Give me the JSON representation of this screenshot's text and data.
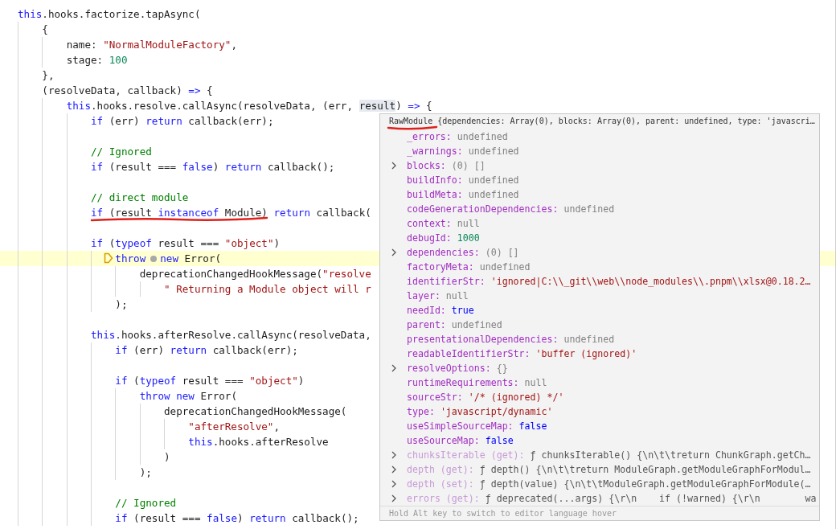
{
  "editor": {
    "lines": [
      {
        "current": false,
        "tokens": [
          {
            "kind": "kw",
            "text": "this"
          },
          {
            "kind": "p",
            "text": ".hooks.factorize.tapAsync("
          }
        ],
        "children": [
          {
            "current": false,
            "tokens": [
              {
                "kind": "p",
                "text": "{"
              }
            ],
            "children": [
              {
                "current": false,
                "tokens": [
                  {
                    "kind": "p",
                    "text": "name: "
                  },
                  {
                    "kind": "str",
                    "text": "\"NormalModuleFactory\""
                  },
                  {
                    "kind": "p",
                    "text": ","
                  }
                ]
              },
              {
                "current": false,
                "tokens": [
                  {
                    "kind": "p",
                    "text": "stage: "
                  },
                  {
                    "kind": "num",
                    "text": "100"
                  }
                ]
              }
            ]
          },
          {
            "current": false,
            "tokens": [
              {
                "kind": "p",
                "text": "},"
              }
            ]
          },
          {
            "current": false,
            "tokens": [
              {
                "kind": "p",
                "text": "(resolveData, callback) "
              },
              {
                "kind": "kw",
                "text": "=>"
              },
              {
                "kind": "p",
                "text": " {"
              }
            ],
            "children": [
              {
                "current": false,
                "tokens": [
                  {
                    "kind": "kw",
                    "text": "this"
                  },
                  {
                    "kind": "p",
                    "text": ".hooks.resolve.callAsync(resolveData, (err, "
                  },
                  {
                    "kind": "hl",
                    "text": "result"
                  },
                  {
                    "kind": "p",
                    "text": ") "
                  },
                  {
                    "kind": "kw",
                    "text": "=>"
                  },
                  {
                    "kind": "p",
                    "text": " {"
                  }
                ],
                "children": [
                  {
                    "current": false,
                    "tokens": [
                      {
                        "kind": "kw",
                        "text": "if"
                      },
                      {
                        "kind": "p",
                        "text": " (err) "
                      },
                      {
                        "kind": "kw",
                        "text": "return"
                      },
                      {
                        "kind": "p",
                        "text": " callback(err);"
                      }
                    ]
                  },
                  {
                    "current": false
                  },
                  {
                    "current": false,
                    "tokens": [
                      {
                        "kind": "cmt",
                        "text": "// Ignored"
                      }
                    ]
                  },
                  {
                    "current": false,
                    "tokens": [
                      {
                        "kind": "kw",
                        "text": "if"
                      },
                      {
                        "kind": "p",
                        "text": " (result === "
                      },
                      {
                        "kind": "kw",
                        "text": "false"
                      },
                      {
                        "kind": "p",
                        "text": ") "
                      },
                      {
                        "kind": "kw",
                        "text": "return"
                      },
                      {
                        "kind": "p",
                        "text": " callback();"
                      }
                    ]
                  },
                  {
                    "current": false
                  },
                  {
                    "current": false,
                    "tokens": [
                      {
                        "kind": "cmt",
                        "text": "// direct module"
                      }
                    ]
                  },
                  {
                    "current": false,
                    "tokens": [
                      {
                        "kind": "kw",
                        "text": "if"
                      },
                      {
                        "kind": "p",
                        "text": " (result "
                      },
                      {
                        "kind": "kw",
                        "text": "instanceof"
                      },
                      {
                        "kind": "p",
                        "text": " Module) "
                      },
                      {
                        "kind": "kw",
                        "text": "return"
                      },
                      {
                        "kind": "p",
                        "text": " callback("
                      }
                    ]
                  },
                  {
                    "current": false
                  },
                  {
                    "current": false,
                    "tokens": [
                      {
                        "kind": "kw",
                        "text": "if"
                      },
                      {
                        "kind": "p",
                        "text": " ("
                      },
                      {
                        "kind": "kw",
                        "text": "typeof"
                      },
                      {
                        "kind": "p",
                        "text": " result === "
                      },
                      {
                        "kind": "str",
                        "text": "\"object\""
                      },
                      {
                        "kind": "p",
                        "text": ")"
                      }
                    ],
                    "children": [
                      {
                        "current": true,
                        "tokens": [
                          {
                            "kind": "kw",
                            "text": "throw"
                          },
                          {
                            "kind": "dot"
                          },
                          {
                            "kind": "kw",
                            "text": "new"
                          },
                          {
                            "kind": "p",
                            "text": " Error("
                          }
                        ],
                        "children": [
                          {
                            "current": false,
                            "tokens": [
                              {
                                "kind": "p",
                                "text": "deprecationChangedHookMessage("
                              },
                              {
                                "kind": "str",
                                "text": "\"resolve"
                              }
                            ],
                            "children": [
                              {
                                "current": false,
                                "tokens": [
                                  {
                                    "kind": "str",
                                    "text": "\" Returning a Module object will r"
                                  }
                                ]
                              }
                            ]
                          }
                        ]
                      },
                      {
                        "current": false,
                        "tokens": [
                          {
                            "kind": "p",
                            "text": ");"
                          }
                        ]
                      }
                    ]
                  },
                  {
                    "current": false
                  },
                  {
                    "current": false,
                    "tokens": [
                      {
                        "kind": "kw",
                        "text": "this"
                      },
                      {
                        "kind": "p",
                        "text": ".hooks.afterResolve.callAsync(resolveData,"
                      }
                    ],
                    "children": [
                      {
                        "current": false,
                        "tokens": [
                          {
                            "kind": "kw",
                            "text": "if"
                          },
                          {
                            "kind": "p",
                            "text": " (err) "
                          },
                          {
                            "kind": "kw",
                            "text": "return"
                          },
                          {
                            "kind": "p",
                            "text": " callback(err);"
                          }
                        ]
                      },
                      {
                        "current": false
                      },
                      {
                        "current": false,
                        "tokens": [
                          {
                            "kind": "kw",
                            "text": "if"
                          },
                          {
                            "kind": "p",
                            "text": " ("
                          },
                          {
                            "kind": "kw",
                            "text": "typeof"
                          },
                          {
                            "kind": "p",
                            "text": " result === "
                          },
                          {
                            "kind": "str",
                            "text": "\"object\""
                          },
                          {
                            "kind": "p",
                            "text": ")"
                          }
                        ],
                        "children": [
                          {
                            "current": false,
                            "tokens": [
                              {
                                "kind": "kw",
                                "text": "throw new"
                              },
                              {
                                "kind": "p",
                                "text": " Error("
                              }
                            ],
                            "children": [
                              {
                                "current": false,
                                "tokens": [
                                  {
                                    "kind": "p",
                                    "text": "deprecationChangedHookMessage("
                                  }
                                ],
                                "children": [
                                  {
                                    "current": false,
                                    "tokens": [
                                      {
                                        "kind": "str",
                                        "text": "\"afterResolve\""
                                      },
                                      {
                                        "kind": "p",
                                        "text": ","
                                      }
                                    ]
                                  },
                                  {
                                    "current": false,
                                    "tokens": [
                                      {
                                        "kind": "kw",
                                        "text": "this"
                                      },
                                      {
                                        "kind": "p",
                                        "text": ".hooks.afterResolve"
                                      }
                                    ]
                                  }
                                ]
                              },
                              {
                                "current": false,
                                "tokens": [
                                  {
                                    "kind": "p",
                                    "text": ")"
                                  }
                                ]
                              }
                            ]
                          },
                          {
                            "current": false,
                            "tokens": [
                              {
                                "kind": "p",
                                "text": ");"
                              }
                            ]
                          }
                        ]
                      },
                      {
                        "current": false
                      },
                      {
                        "current": false,
                        "tokens": [
                          {
                            "kind": "cmt",
                            "text": "// Ignored"
                          }
                        ]
                      },
                      {
                        "current": false,
                        "tokens": [
                          {
                            "kind": "kw",
                            "text": "if"
                          },
                          {
                            "kind": "p",
                            "text": " (result === "
                          },
                          {
                            "kind": "kw",
                            "text": "false"
                          },
                          {
                            "kind": "p",
                            "text": ") "
                          },
                          {
                            "kind": "kw",
                            "text": "return"
                          },
                          {
                            "kind": "p",
                            "text": " callback();"
                          }
                        ]
                      }
                    ]
                  }
                ]
              }
            ]
          }
        ]
      }
    ]
  },
  "hover": {
    "header": "RawModule {dependencies: Array(0), blocks: Array(0), parent: undefined, type: 'javascri…",
    "rows": [
      {
        "expandable": false,
        "key": "_errors:",
        "kind": "undefined",
        "value": "undefined"
      },
      {
        "expandable": false,
        "key": "_warnings:",
        "kind": "undefined",
        "value": "undefined"
      },
      {
        "expandable": true,
        "key": "blocks:",
        "kind": "array",
        "value": "(0) []"
      },
      {
        "expandable": false,
        "key": "buildInfo:",
        "kind": "undefined",
        "value": "undefined"
      },
      {
        "expandable": false,
        "key": "buildMeta:",
        "kind": "undefined",
        "value": "undefined"
      },
      {
        "expandable": false,
        "key": "codeGenerationDependencies:",
        "kind": "undefined",
        "value": "undefined"
      },
      {
        "expandable": false,
        "key": "context:",
        "kind": "null",
        "value": "null"
      },
      {
        "expandable": false,
        "key": "debugId:",
        "kind": "number",
        "value": "1000"
      },
      {
        "expandable": true,
        "key": "dependencies:",
        "kind": "array",
        "value": "(0) []"
      },
      {
        "expandable": false,
        "key": "factoryMeta:",
        "kind": "undefined",
        "value": "undefined"
      },
      {
        "expandable": false,
        "key": "identifierStr:",
        "kind": "string",
        "value": "'ignored|C:\\\\_git\\\\web\\\\node_modules\\\\.pnpm\\\\xlsx@0.18.2…"
      },
      {
        "expandable": false,
        "key": "layer:",
        "kind": "null",
        "value": "null"
      },
      {
        "expandable": false,
        "key": "needId:",
        "kind": "boolean",
        "value": "true"
      },
      {
        "expandable": false,
        "key": "parent:",
        "kind": "undefined",
        "value": "undefined"
      },
      {
        "expandable": false,
        "key": "presentationalDependencies:",
        "kind": "undefined",
        "value": "undefined"
      },
      {
        "expandable": false,
        "key": "readableIdentifierStr:",
        "kind": "string",
        "value": "'buffer (ignored)'"
      },
      {
        "expandable": true,
        "key": "resolveOptions:",
        "kind": "object",
        "value": "{}"
      },
      {
        "expandable": false,
        "key": "runtimeRequirements:",
        "kind": "null",
        "value": "null"
      },
      {
        "expandable": false,
        "key": "sourceStr:",
        "kind": "string",
        "value": "'/* (ignored) */'"
      },
      {
        "expandable": false,
        "key": "type:",
        "kind": "string",
        "value": "'javascript/dynamic'"
      },
      {
        "expandable": false,
        "key": "useSimpleSourceMap:",
        "kind": "boolean",
        "value": "false"
      },
      {
        "expandable": false,
        "key": "useSourceMap:",
        "kind": "boolean",
        "value": "false"
      },
      {
        "expandable": true,
        "key": "chunksIterable (get):",
        "kind": "function",
        "value": "ƒ chunksIterable() {\\n\\t\\treturn ChunkGraph.getCh…"
      },
      {
        "expandable": true,
        "key": "depth (get):",
        "kind": "function",
        "value": "ƒ depth() {\\n\\t\\treturn ModuleGraph.getModuleGraphForModul…"
      },
      {
        "expandable": true,
        "key": "depth (set):",
        "kind": "function",
        "value": "ƒ depth(value) {\\n\\t\\tModuleGraph.getModuleGraphForModule(…"
      },
      {
        "expandable": true,
        "key": "errors (get):",
        "kind": "function",
        "value": "ƒ deprecated(...args) {\\r\\n    if (!warned) {\\r\\n        wa"
      }
    ],
    "footer": "Hold Alt key to switch to editor language hover"
  }
}
